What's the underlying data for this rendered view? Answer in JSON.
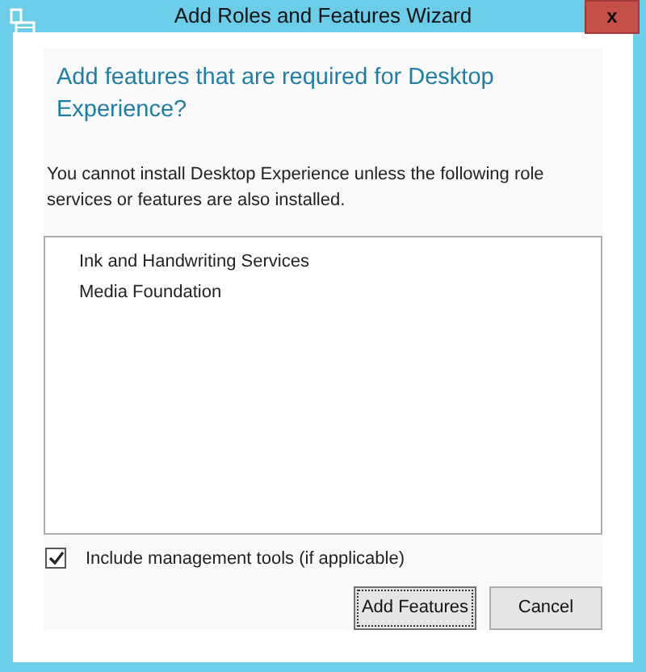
{
  "window": {
    "title": "Add Roles and Features Wizard",
    "close": "x"
  },
  "heading": "Add features that are required for Desktop Experience?",
  "description": "You cannot install Desktop Experience unless the following role services or features are also installed.",
  "features": [
    {
      "label": "Ink and Handwriting Services"
    },
    {
      "label": "Media Foundation"
    }
  ],
  "include_tools": {
    "label": "Include management tools (if applicable)",
    "checked": true
  },
  "buttons": [
    {
      "label": "Add Features",
      "focused": true
    },
    {
      "label": "Cancel",
      "focused": false
    }
  ]
}
